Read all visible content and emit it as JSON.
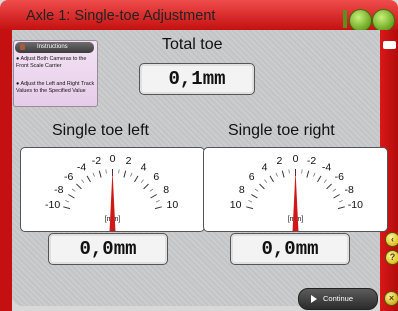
{
  "window": {
    "title": "Axle 1: Single-toe Adjustment"
  },
  "instructions": {
    "title": "Instructions",
    "items": [
      "Adjust Both Cameras to the Front Scale Carrier",
      "Adjust the Left and Right Track Values to the Specified Value"
    ]
  },
  "total_toe": {
    "label": "Total toe",
    "value": "0,1mm"
  },
  "left": {
    "label": "Single toe left",
    "readout": "0,0mm",
    "unit": "[mm]",
    "ticks": [
      "-10",
      "-8",
      "-6",
      "-4",
      "-2",
      "0",
      "2",
      "4",
      "6",
      "8",
      "10"
    ],
    "needle_value": 0
  },
  "right": {
    "label": "Single toe right",
    "readout": "0,0mm",
    "unit": "[mm]",
    "ticks": [
      "10",
      "8",
      "6",
      "4",
      "2",
      "0",
      "-2",
      "-4",
      "-6",
      "-8",
      "-10"
    ],
    "needle_value": 0
  },
  "continue_button": {
    "label": "Continue"
  },
  "side_buttons": {
    "back": "‹",
    "help": "?",
    "close": "×"
  },
  "colors": {
    "accent": "#c41010",
    "needle": "#d01818",
    "window_buttons": "#6aa521"
  }
}
